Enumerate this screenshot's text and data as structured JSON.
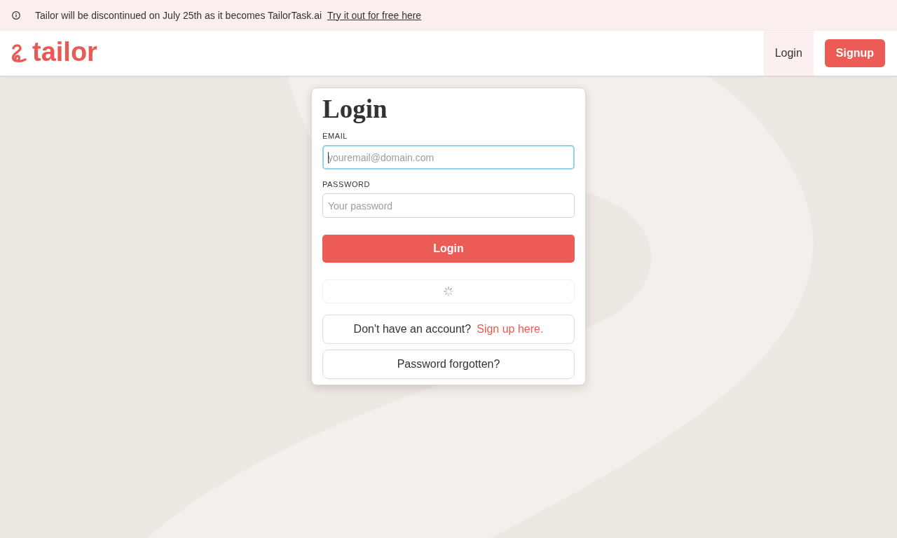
{
  "banner": {
    "message": "Tailor will be discontinued on July 25th as it becomes TailorTask.ai",
    "link": "Try it out for free here"
  },
  "navbar": {
    "logo": "tailor",
    "items": [
      {
        "label": "Login",
        "kind": "link",
        "selected": true
      },
      {
        "label": "Signup",
        "kind": "button",
        "selected": false
      }
    ]
  },
  "login_card": {
    "title": "Login",
    "fields": [
      {
        "label": "EMAIL",
        "placeholder": "youremail@domain.com",
        "focused": true
      },
      {
        "label": "PASSWORD",
        "placeholder": "Your password",
        "focused": false
      }
    ],
    "submit": "Login",
    "loading": true,
    "signup_prompt": {
      "text": "Don't have an account?",
      "link": "Sign up here."
    },
    "forgot_password": "Password forgotten?"
  }
}
